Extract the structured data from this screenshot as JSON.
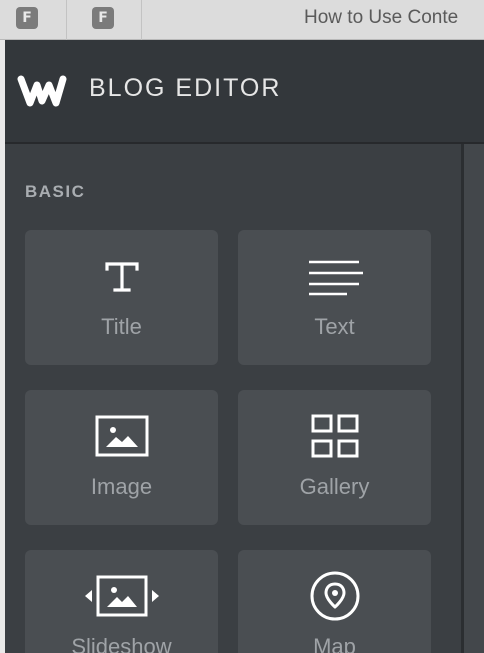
{
  "browser": {
    "tab1_favicon_letter": "F",
    "tab2_favicon_letter": "F",
    "active_tab_title": "How to Use Conte"
  },
  "header": {
    "logo_icon": "weebly-w-logo-icon",
    "title": "BLOG EDITOR"
  },
  "sidebar": {
    "section_label": "BASIC",
    "items": [
      {
        "label": "Title",
        "icon": "title-T-icon"
      },
      {
        "label": "Text",
        "icon": "text-lines-icon"
      },
      {
        "label": "Image",
        "icon": "image-icon"
      },
      {
        "label": "Gallery",
        "icon": "gallery-grid-icon"
      },
      {
        "label": "Slideshow",
        "icon": "slideshow-icon"
      },
      {
        "label": "Map",
        "icon": "map-pin-icon"
      }
    ]
  },
  "colors": {
    "header_bg": "#33373b",
    "panel_bg": "#3b3f43",
    "tile_bg": "#4a4e52",
    "icon_color": "#ffffff",
    "label_color": "#9fa3a7"
  }
}
